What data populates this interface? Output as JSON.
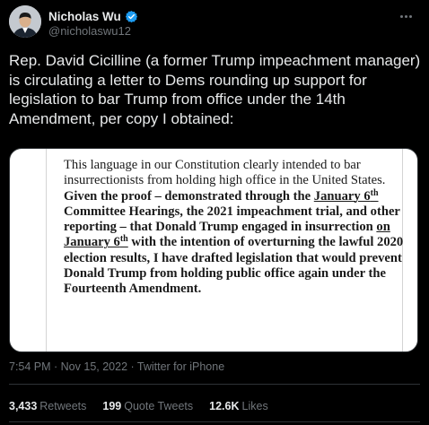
{
  "author": {
    "display_name": "Nicholas Wu",
    "handle": "@nicholaswu12"
  },
  "tweet": {
    "text": "Rep. David Cicilline (a former Trump impeachment manager) is circulating a letter to Dems rounding up support for legislation to bar Trump from office under the 14th Amendment, per copy I obtained:"
  },
  "document": {
    "p1": "This language in our Constitution clearly intended to bar insurrectionists from holding high office in the United States. ",
    "p2": "Given the proof – demonstrated through the ",
    "p3": "January 6",
    "p3_sup": "th",
    "p4": " Committee Hearings, the 2021 impeachment trial, and other reporting – that Donald Trump engaged in insurrection ",
    "p5": "on January 6",
    "p5_sup": "th",
    "p6": " with the intention of overturning the lawful 2020 election results, I have drafted legislation that would prevent Donald Trump from holding public office again under the Fourteenth Amendment."
  },
  "meta": {
    "timestamp": "7:54 PM · Nov 15, 2022 · Twitter for iPhone"
  },
  "stats": {
    "retweets_count": "3,433",
    "retweets_label": "Retweets",
    "quotes_count": "199",
    "quotes_label": "Quote Tweets",
    "likes_count": "12.6K",
    "likes_label": "Likes"
  },
  "colors": {
    "background": "#000000",
    "text": "#e7e9ea",
    "secondary": "#71767b",
    "verified": "#1d9bf0",
    "divider": "#2f3336"
  },
  "icons": [
    "avatar",
    "verified-badge-icon",
    "more-options-icon"
  ]
}
